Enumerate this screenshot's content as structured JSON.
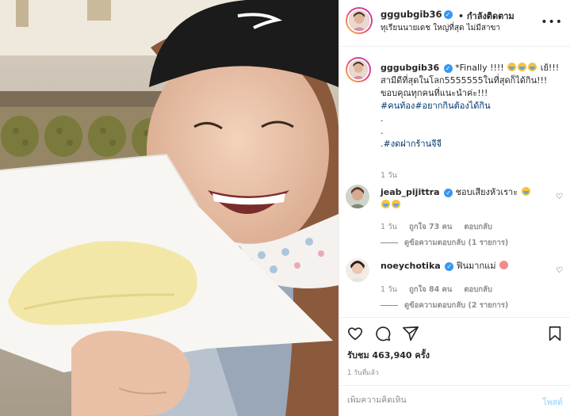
{
  "header": {
    "username": "gggubgib36",
    "follow_label": "• กำลังติดตาม",
    "location": "ทุเรียนนายเดช ใหญ่ที่สุด ไม่มีสาขา"
  },
  "caption": {
    "username": "gggubgib36",
    "text_line1": "*Finally !!!!",
    "text_line2": "เย้!!!สามีดีที่สุดในโลก5555555ในที่สุดก็ได้กิน!!! ขอบคุณทุกคนที่แนะนำค่ะ!!!",
    "hashtags": "#คนท้อง#อยากกินต้องได้กิน",
    "dot1": ".",
    "dot2": ".",
    "hashtag2": ".#งดฝากร้านจีจี",
    "time": "1 วัน"
  },
  "comments": [
    {
      "username": "jeab_pijittra",
      "text": "ชอบเสียงหัวเราะ",
      "time": "1 วัน",
      "likes": "ถูกใจ 73 คน",
      "reply": "ตอบกลับ",
      "view_replies": "ดูข้อความตอบกลับ (1 รายการ)"
    },
    {
      "username": "noeychotika",
      "text": "ฟินมากแม่",
      "time": "1 วัน",
      "likes": "ถูกใจ 84 คน",
      "reply": "ตอบกลับ",
      "view_replies": "ดูข้อความตอบกลับ (2 รายการ)"
    }
  ],
  "actions": {
    "likes_count": "รับชม 463,940 ครั้ง",
    "posted_ago": "1 วันที่แล้ว",
    "comment_placeholder": "เพิ่มความคิดเห็น",
    "post_label": "โพสต์"
  },
  "icons": {
    "like": "heart-icon",
    "comment": "comment-icon",
    "share": "share-icon",
    "save": "bookmark-icon",
    "more": "more-icon",
    "verified": "verified-badge-icon"
  },
  "colors": {
    "link": "#00376b",
    "verified": "#3897f0",
    "muted": "#8e8e8e",
    "post_disabled": "#b2dffc"
  }
}
